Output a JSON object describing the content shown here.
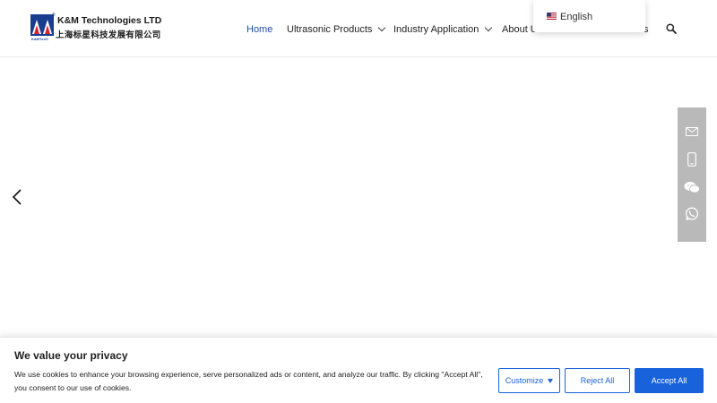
{
  "brand": {
    "name_en": "K&M Technologies LTD",
    "name_cn": "上海标星科技发展有限公司",
    "mark_text": "KaMTech",
    "registered": "®",
    "colors": {
      "blue": "#1a3d8f",
      "red": "#d9232d"
    }
  },
  "nav": {
    "items": [
      {
        "label": "Home",
        "active": true
      },
      {
        "label": "Ultrasonic Products",
        "has_dropdown": true
      },
      {
        "label": "Industry Application",
        "has_dropdown": true
      },
      {
        "label": "About U"
      },
      {
        "label": "s"
      }
    ],
    "search_icon": "search-icon",
    "active_color": "#1a4fa0"
  },
  "language": {
    "selected": "English",
    "flag_icon": "us-flag-icon"
  },
  "slider": {
    "prev_icon": "chevron-left-icon",
    "next_icon": "chevron-right-icon"
  },
  "contact_bar": {
    "items": [
      "mail-icon",
      "phone-icon",
      "wechat-icon",
      "whatsapp-icon"
    ],
    "background": "#b9b9b9"
  },
  "cookie_banner": {
    "title": "We value your privacy",
    "text": "We use cookies to enhance your browsing experience, serve personalized ads or content, and analyze our traffic. By clicking \"Accept All\", you consent to our use of cookies.",
    "customize_label": "Customize",
    "reject_label": "Reject All",
    "accept_label": "Accept All",
    "accent": "#1863dc"
  }
}
